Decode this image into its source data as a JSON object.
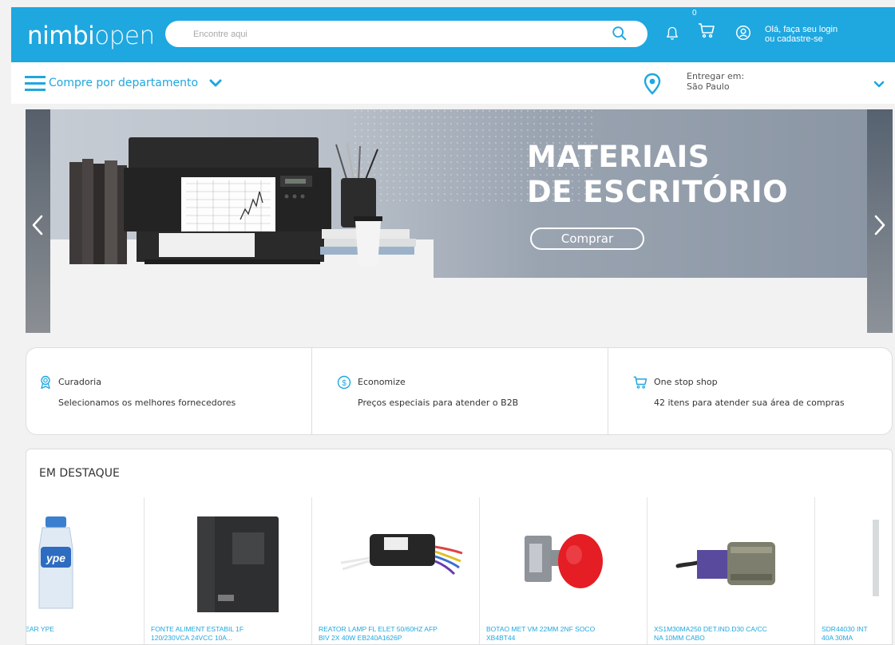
{
  "header": {
    "logo_part1": "nimbi",
    "logo_part2": "open",
    "search_placeholder": "Encontre aqui",
    "cart_count": "0",
    "login_line1": "Olá, faça seu login",
    "login_line2": "ou cadastre-se"
  },
  "nav": {
    "department_label": "Compre por departamento",
    "deliver_label": "Entregar em:",
    "deliver_city": "São Paulo"
  },
  "banner": {
    "headline_line1": "MATERIAIS",
    "headline_line2": "DE ESCRITÓRIO",
    "button_label": "Comprar"
  },
  "features": [
    {
      "title": "Curadoria",
      "description": "Selecionamos os melhores fornecedores",
      "icon": "award-icon"
    },
    {
      "title": "Economize",
      "description": "Preços especiais para atender o B2B",
      "icon": "dollar-coin-icon"
    },
    {
      "title": "One stop shop",
      "description": "42 itens para atender sua área de compras",
      "icon": "cart-icon"
    }
  ],
  "featured": {
    "title": "EM DESTAQUE",
    "products": [
      {
        "name_line1": "E LIQUIDO CLEAR YPE",
        "name_line2": "",
        "image": "detergent-bottle"
      },
      {
        "name_line1": "FONTE ALIMENT ESTABIL 1F",
        "name_line2": "120/230VCA 24VCC 10A...",
        "image": "power-supply"
      },
      {
        "name_line1": "REATOR LAMP FL ELET 50/60HZ AFP",
        "name_line2": "BIV 2X 40W EB240A1626P",
        "image": "electronic-ballast"
      },
      {
        "name_line1": "BOTAO MET VM 22MM 2NF SOCO",
        "name_line2": "XB4BT44",
        "image": "red-push-button"
      },
      {
        "name_line1": "XS1M30MA250 DET.IND.D30 CA/CC",
        "name_line2": "NA 10MM CABO",
        "image": "inductive-sensor"
      },
      {
        "name_line1": "SDR44030 INT",
        "name_line2": "40A 30MA",
        "image": "switch"
      }
    ]
  },
  "colors": {
    "brand_blue": "#1fa7e0",
    "page_background": "#f2f2f2"
  }
}
